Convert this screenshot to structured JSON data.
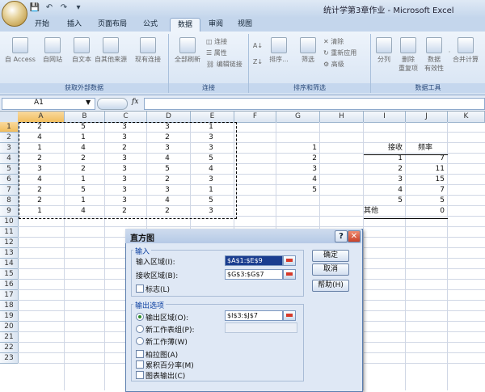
{
  "window": {
    "title": "统计学第3章作业 - Microsoft Excel"
  },
  "qat": {
    "save": "💾",
    "undo": "↶",
    "redo": "↷",
    "more": "▾"
  },
  "tabs": [
    "开始",
    "插入",
    "页面布局",
    "公式",
    "数据",
    "审阅",
    "视图"
  ],
  "active_tab": "数据",
  "ribbon": {
    "groups": {
      "external": "获取外部数据",
      "connections": "连接",
      "sort_filter": "排序和筛选",
      "data_tools": "数据工具"
    },
    "external_buttons": [
      "自 Access",
      "自网站",
      "自文本",
      "自其他来源",
      "现有连接"
    ],
    "refresh_all": "全部刷新",
    "connections_items": [
      "连接",
      "属性",
      "编辑链接"
    ],
    "sort": "排序...",
    "filter": "筛选",
    "filter_items": [
      "清除",
      "重新应用",
      "高级"
    ],
    "data_tools_buttons": [
      "分列",
      "删除\n重复项",
      "数据\n有效性",
      "合并计算"
    ],
    "data_tools_extra": [
      "·",
      "·"
    ]
  },
  "formula_bar": {
    "name_box": "A1",
    "fx": "fx",
    "formula": ""
  },
  "columns": [
    "A",
    "B",
    "C",
    "D",
    "E",
    "F",
    "G",
    "H",
    "I",
    "J",
    "K"
  ],
  "rows": [
    "1",
    "2",
    "3",
    "4",
    "5",
    "6",
    "7",
    "8",
    "9",
    "10",
    "11",
    "12",
    "13",
    "14",
    "15",
    "16",
    "17",
    "18",
    "19",
    "20",
    "21",
    "22",
    "23"
  ],
  "data_a_e": [
    [
      "2",
      "5",
      "3",
      "3",
      "1"
    ],
    [
      "4",
      "1",
      "3",
      "2",
      "3"
    ],
    [
      "1",
      "4",
      "2",
      "3",
      "3"
    ],
    [
      "2",
      "2",
      "3",
      "4",
      "5"
    ],
    [
      "3",
      "2",
      "3",
      "5",
      "4"
    ],
    [
      "4",
      "1",
      "3",
      "2",
      "3"
    ],
    [
      "2",
      "5",
      "3",
      "3",
      "1"
    ],
    [
      "2",
      "1",
      "3",
      "4",
      "5"
    ],
    [
      "1",
      "4",
      "2",
      "2",
      "3"
    ]
  ],
  "bins_g": [
    "1",
    "2",
    "3",
    "4",
    "5"
  ],
  "output": {
    "headers": [
      "接收",
      "频率"
    ],
    "rows": [
      [
        "1",
        "7"
      ],
      [
        "2",
        "11"
      ],
      [
        "3",
        "15"
      ],
      [
        "4",
        "7"
      ],
      [
        "5",
        "5"
      ],
      [
        "其他",
        "0"
      ]
    ]
  },
  "dialog": {
    "title": "直方图",
    "help_btn": "?",
    "close_btn": "✕",
    "input_legend": "输入",
    "input_range_label": "输入区域(I):",
    "input_range_value": "$A$1:$E$9",
    "bin_range_label": "接收区域(B):",
    "bin_range_value": "$G$3:$G$7",
    "labels_label": "标志(L)",
    "output_legend": "输出选项",
    "output_range_label": "输出区域(O):",
    "output_range_value": "$I$3:$J$7",
    "new_ws_label": "新工作表组(P):",
    "new_wb_label": "新工作薄(W)",
    "pareto_label": "柏拉图(A)",
    "cumulative_label": "累积百分率(M)",
    "chart_label": "图表输出(C)",
    "ok": "确定",
    "cancel": "取消",
    "help": "帮助(H)"
  }
}
